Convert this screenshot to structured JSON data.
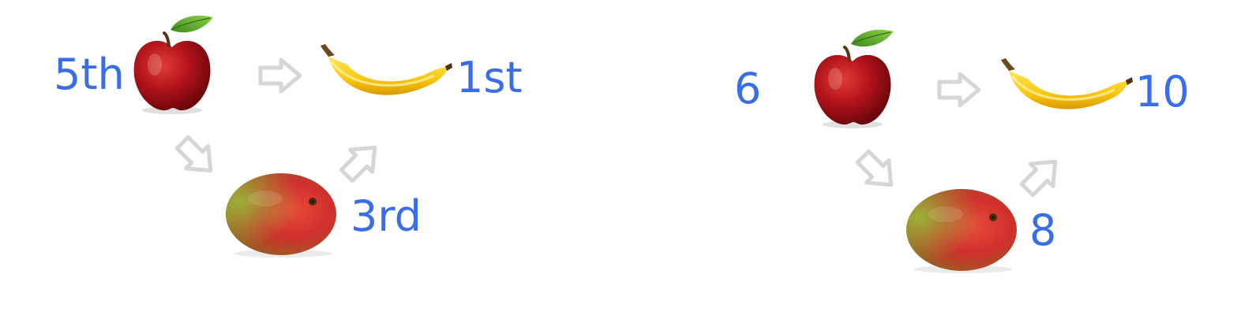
{
  "colors": {
    "label": "#3a6ee8",
    "arrow_fill": "#ffffff",
    "arrow_stroke": "#d6d6d6"
  },
  "icons": {
    "apple": "apple-icon",
    "banana": "banana-icon",
    "mango": "mango-icon",
    "arrow": "hollow-arrow-icon"
  },
  "diagrams": [
    {
      "apple_label": "5th",
      "banana_label": "1st",
      "mango_label": "3rd"
    },
    {
      "apple_label": "6",
      "banana_label": "10",
      "mango_label": "8"
    }
  ]
}
